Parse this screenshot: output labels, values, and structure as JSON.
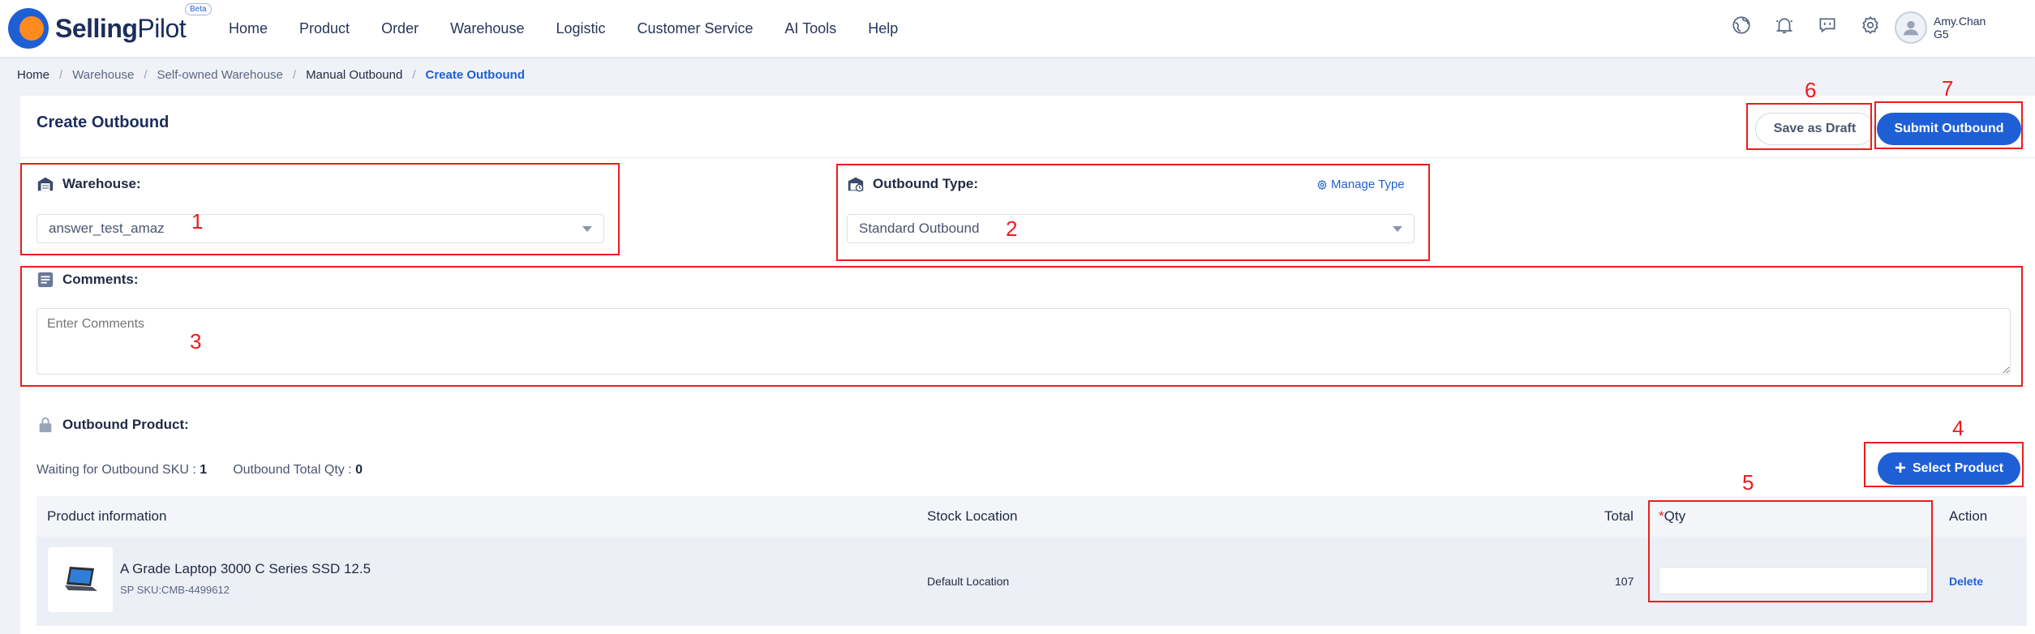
{
  "brand": {
    "name_bold": "Selling",
    "name_light": "Pilot",
    "badge": "Beta"
  },
  "nav": {
    "items": [
      "Home",
      "Product",
      "Order",
      "Warehouse",
      "Logistic",
      "Customer Service",
      "AI Tools",
      "Help"
    ],
    "icons": [
      "globe-icon",
      "bell-icon",
      "message-icon",
      "settings-icon"
    ]
  },
  "user": {
    "name": "Amy.Chan",
    "code": "G5"
  },
  "breadcrumb": [
    "Home",
    "Warehouse",
    "Self-owned Warehouse",
    "Manual Outbound",
    "Create Outbound"
  ],
  "page": {
    "title": "Create Outbound",
    "save_draft": "Save as Draft",
    "submit": "Submit Outbound"
  },
  "form": {
    "warehouse_label": "Warehouse:",
    "warehouse_value": "answer_test_amaz",
    "outbound_type_label": "Outbound Type:",
    "manage_type": "Manage Type",
    "outbound_type_value": "Standard Outbound",
    "comments_label": "Comments:",
    "comments_placeholder": "Enter Comments"
  },
  "product_section": {
    "title": "Outbound Product:",
    "waiting_label": "Waiting for Outbound SKU :",
    "waiting_value": "1",
    "total_label": "Outbound Total Qty :",
    "total_value": "0",
    "select_button": "Select Product"
  },
  "table": {
    "headers": {
      "product": "Product information",
      "stock": "Stock Location",
      "total": "Total",
      "qty_required": "*",
      "qty": "Qty",
      "action": "Action"
    },
    "rows": [
      {
        "name": "A Grade Laptop 3000 C Series SSD 12.5",
        "sku": "SP SKU:CMB-4499612",
        "stock_location": "Default Location",
        "total": "107",
        "qty": "",
        "action": "Delete"
      }
    ]
  },
  "annotations": [
    "1",
    "2",
    "3",
    "4",
    "5",
    "6",
    "7"
  ],
  "colors": {
    "primary": "#1f5fd6",
    "annotation": "#ee1c1c",
    "brand_orange": "#ff8a1e"
  }
}
